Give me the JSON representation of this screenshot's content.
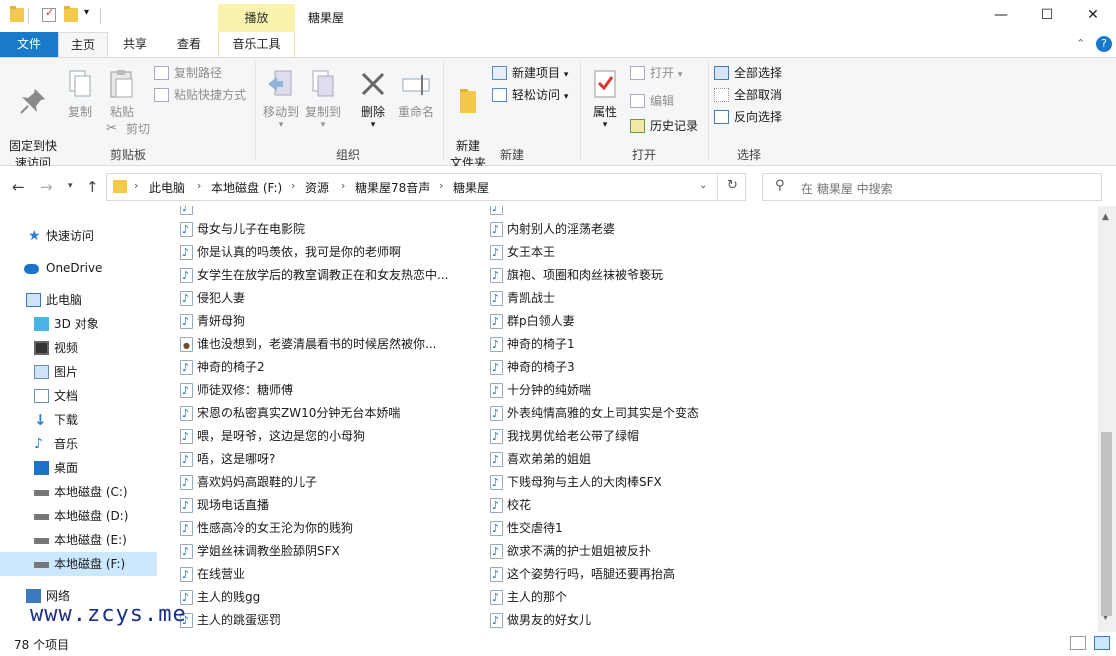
{
  "window": {
    "title": "糖果屋",
    "contextual_tab_group": "播放",
    "minimize_glyph": "—",
    "maximize_glyph": "☐",
    "close_glyph": "✕"
  },
  "tabs": [
    "文件",
    "主页",
    "共享",
    "查看",
    "音乐工具"
  ],
  "ribbon": {
    "clipboard": {
      "pin": "固定到快\n速访问",
      "copy": "复制",
      "paste": "粘贴",
      "copy_path": "复制路径",
      "paste_shortcut": "粘贴快捷方式",
      "cut": "剪切",
      "label": "剪贴板"
    },
    "organize": {
      "move_to": "移动到",
      "copy_to": "复制到",
      "delete": "删除",
      "rename": "重命名",
      "label": "组织"
    },
    "new": {
      "new_folder": "新建\n文件夹",
      "new_item": "新建项目",
      "easy_access": "轻松访问",
      "label": "新建"
    },
    "open": {
      "properties": "属性",
      "open": "打开",
      "edit": "编辑",
      "history": "历史记录",
      "label": "打开"
    },
    "select": {
      "select_all": "全部选择",
      "select_none": "全部取消",
      "invert": "反向选择",
      "label": "选择"
    }
  },
  "address": {
    "crumbs": [
      "此电脑",
      "本地磁盘 (F:)",
      "资源",
      "糖果屋78音声",
      "糖果屋"
    ],
    "search_placeholder": "在 糖果屋 中搜索"
  },
  "nav": [
    {
      "label": "快速访问",
      "icon": "star-icon"
    },
    {
      "label": "OneDrive",
      "icon": "cloud-icon"
    },
    {
      "label": "此电脑",
      "icon": "computer-icon"
    },
    {
      "label": "3D 对象",
      "icon": "cube-icon"
    },
    {
      "label": "视频",
      "icon": "video-icon"
    },
    {
      "label": "图片",
      "icon": "picture-icon"
    },
    {
      "label": "文档",
      "icon": "document-icon"
    },
    {
      "label": "下载",
      "icon": "download-icon"
    },
    {
      "label": "音乐",
      "icon": "music-icon"
    },
    {
      "label": "桌面",
      "icon": "desktop-icon"
    },
    {
      "label": "本地磁盘 (C:)",
      "icon": "drive-icon"
    },
    {
      "label": "本地磁盘 (D:)",
      "icon": "drive-icon"
    },
    {
      "label": "本地磁盘 (E:)",
      "icon": "drive-icon"
    },
    {
      "label": "本地磁盘 (F:)",
      "icon": "drive-icon"
    },
    {
      "label": "网络",
      "icon": "network-icon"
    }
  ],
  "files_left": [
    "母女与儿子在电影院",
    "你是认真的吗羡依，我可是你的老师啊",
    "女学生在放学后的教室调教正在和女友热恋中...",
    "侵犯人妻",
    "青妍母狗",
    "谁也没想到，老婆清晨看书的时候居然被你...",
    "神奇的椅子2",
    "师徒双修：糖师傅",
    "宋恩の私密真实ZW10分钟无台本娇喘",
    "喂，是呀爷，这边是您的小母狗",
    "唔，这是哪呀?",
    "喜欢妈妈高跟鞋的儿子",
    "现场电话直播",
    "性感高冷的女王沦为你的贱狗",
    "学姐丝袜调教坐脸舔阴SFX",
    "在线营业",
    "主人的贱gg",
    "主人的跳蛋惩罚"
  ],
  "files_right": [
    "内射别人的淫荡老婆",
    "女王本王",
    "旗袍、项圈和肉丝袜被爷亵玩",
    "青凯战士",
    "群p白领人妻",
    "神奇的椅子1",
    "神奇的椅子3",
    "十分钟的纯娇喘",
    "外表纯情高雅的女上司其实是个变态",
    "我找男优给老公带了绿帽",
    "喜欢弟弟的姐姐",
    "下贱母狗与主人的大肉棒SFX",
    "校花",
    "性交虐待1",
    "欲求不满的护士姐姐被反扑",
    "这个姿势行吗，唔腿还要再抬高",
    "主人的那个",
    "做男友的好女儿"
  ],
  "status": {
    "count": "78 个项目"
  },
  "watermark": "www.zcys.me",
  "colors": {
    "file_tab": "#1979ca",
    "music_tools": "#faf3b0",
    "selected_nav": "#cce8ff"
  }
}
